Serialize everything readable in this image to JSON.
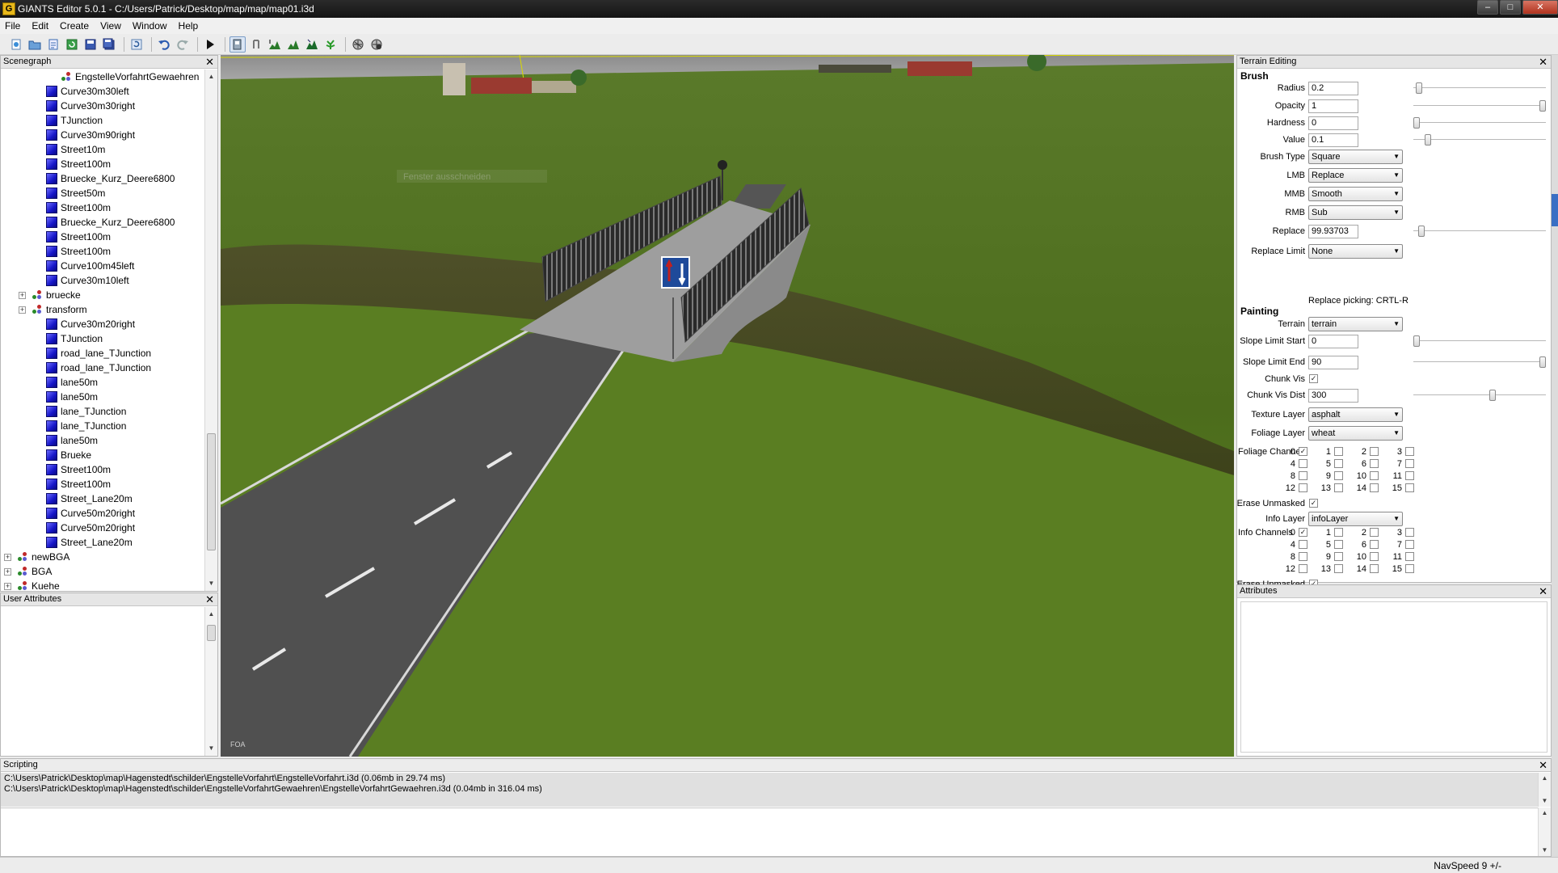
{
  "window": {
    "title": "GIANTS Editor 5.0.1 - C:/Users/Patrick/Desktop/map/map/map01.i3d",
    "icon_letter": "G",
    "controls": [
      "minimize-icon",
      "maximize-icon",
      "close-icon"
    ]
  },
  "menu": [
    "File",
    "Edit",
    "Create",
    "View",
    "Window",
    "Help"
  ],
  "toolbar": {
    "icons": [
      "new-icon",
      "open-icon",
      "import-icon",
      "reload-icon",
      "save-icon",
      "save-all-icon",
      "refresh-icon",
      "undo-icon",
      "redo-icon",
      "play-icon",
      "select-mode-icon",
      "move-mode-icon",
      "terrain-sculpt-icon",
      "terrain-paint-icon",
      "terrain-smooth-icon",
      "foliage-paint-icon",
      "grid-icon",
      "grid-settings-icon"
    ]
  },
  "scenegraph": {
    "title": "Scenegraph",
    "items": [
      {
        "label": "EngstelleVorfahrtGewaehren",
        "type": "transform",
        "level": 3
      },
      {
        "label": "Curve30m30left",
        "type": "shape",
        "level": 2
      },
      {
        "label": "Curve30m30right",
        "type": "shape",
        "level": 2
      },
      {
        "label": "TJunction",
        "type": "shape",
        "level": 2
      },
      {
        "label": "Curve30m90right",
        "type": "shape",
        "level": 2
      },
      {
        "label": "Street10m",
        "type": "shape",
        "level": 2
      },
      {
        "label": "Street100m",
        "type": "shape",
        "level": 2
      },
      {
        "label": "Bruecke_Kurz_Deere6800",
        "type": "shape",
        "level": 2
      },
      {
        "label": "Street50m",
        "type": "shape",
        "level": 2
      },
      {
        "label": "Street100m",
        "type": "shape",
        "level": 2
      },
      {
        "label": "Bruecke_Kurz_Deere6800",
        "type": "shape",
        "level": 2
      },
      {
        "label": "Street100m",
        "type": "shape",
        "level": 2
      },
      {
        "label": "Street100m",
        "type": "shape",
        "level": 2
      },
      {
        "label": "Curve100m45left",
        "type": "shape",
        "level": 2
      },
      {
        "label": "Curve30m10left",
        "type": "shape",
        "level": 2
      },
      {
        "label": "bruecke",
        "type": "transform",
        "level": 1,
        "expandable": true
      },
      {
        "label": "transform",
        "type": "transform",
        "level": 1,
        "expandable": true
      },
      {
        "label": "Curve30m20right",
        "type": "shape",
        "level": 2
      },
      {
        "label": "TJunction",
        "type": "shape",
        "level": 2
      },
      {
        "label": "road_lane_TJunction",
        "type": "shape",
        "level": 2
      },
      {
        "label": "road_lane_TJunction",
        "type": "shape",
        "level": 2
      },
      {
        "label": "lane50m",
        "type": "shape",
        "level": 2
      },
      {
        "label": "lane50m",
        "type": "shape",
        "level": 2
      },
      {
        "label": "lane_TJunction",
        "type": "shape",
        "level": 2
      },
      {
        "label": "lane_TJunction",
        "type": "shape",
        "level": 2
      },
      {
        "label": "lane50m",
        "type": "shape",
        "level": 2
      },
      {
        "label": "Brueke",
        "type": "shape",
        "level": 2
      },
      {
        "label": "Street100m",
        "type": "shape",
        "level": 2
      },
      {
        "label": "Street100m",
        "type": "shape",
        "level": 2
      },
      {
        "label": "Street_Lane20m",
        "type": "shape",
        "level": 2
      },
      {
        "label": "Curve50m20right",
        "type": "shape",
        "level": 2
      },
      {
        "label": "Curve50m20right",
        "type": "shape",
        "level": 2
      },
      {
        "label": "Street_Lane20m",
        "type": "shape",
        "level": 2
      },
      {
        "label": "newBGA",
        "type": "transform",
        "level": 0,
        "expandable": true
      },
      {
        "label": "BGA",
        "type": "transform",
        "level": 0,
        "expandable": true
      },
      {
        "label": "Kuehe",
        "type": "transform",
        "level": 0,
        "expandable": true
      }
    ]
  },
  "user_attributes": {
    "title": "User Attributes"
  },
  "viewport": {
    "overlay_text": "Fenster ausschneiden",
    "corner_text": "FOA",
    "colors": {
      "sky": "#9a9a9a",
      "grass": "#4f6e1f",
      "road": "#555555"
    }
  },
  "terrain_editing": {
    "title": "Terrain Editing",
    "brush_section": "Brush",
    "fields": [
      {
        "label": "Radius",
        "value": "0.2",
        "slider": 0.02
      },
      {
        "label": "Opacity",
        "value": "1",
        "slider": 1.0
      },
      {
        "label": "Hardness",
        "value": "0",
        "slider": 0.0
      },
      {
        "label": "Value",
        "value": "0.1",
        "slider": 0.09
      }
    ],
    "brush_type": {
      "label": "Brush Type",
      "value": "Square"
    },
    "lmb": {
      "label": "LMB",
      "value": "Replace"
    },
    "mmb": {
      "label": "MMB",
      "value": "Smooth"
    },
    "rmb": {
      "label": "RMB",
      "value": "Sub"
    },
    "replace": {
      "label": "Replace",
      "value": "99.93703",
      "slider": 0.04
    },
    "replace_limit": {
      "label": "Replace Limit",
      "value": "None"
    },
    "replace_picking": "Replace picking: CRTL-R",
    "painting_section": "Painting",
    "terrain": {
      "label": "Terrain",
      "value": "terrain"
    },
    "slope_start": {
      "label": "Slope Limit Start",
      "value": "0",
      "slider": 0.0
    },
    "slope_end": {
      "label": "Slope Limit End",
      "value": "90",
      "slider": 1.0
    },
    "chunk_vis": {
      "label": "Chunk Vis",
      "checked": true
    },
    "chunk_vis_dist": {
      "label": "Chunk Vis Dist",
      "value": "300",
      "slider": 0.6
    },
    "texture_layer": {
      "label": "Texture Layer",
      "value": "asphalt"
    },
    "foliage_layer": {
      "label": "Foliage Layer",
      "value": "wheat"
    },
    "foliage_channels": {
      "label": "Foliage Channels",
      "checked": [
        0
      ]
    },
    "erase_unmasked_1": {
      "label": "Erase Unmasked",
      "checked": true
    },
    "info_layer": {
      "label": "Info Layer",
      "value": "infoLayer"
    },
    "info_channels": {
      "label": "Info Channels",
      "checked": [
        0
      ]
    },
    "erase_unmasked_2": {
      "label": "Erase Unmasked",
      "checked": true
    },
    "channel_numbers": [
      "0",
      "1",
      "2",
      "3",
      "4",
      "5",
      "6",
      "7",
      "8",
      "9",
      "10",
      "11",
      "12",
      "13",
      "14",
      "15"
    ]
  },
  "attributes": {
    "title": "Attributes"
  },
  "scripting": {
    "title": "Scripting",
    "log": [
      "C:\\Users\\Patrick\\Desktop\\map\\Hagenstedt\\schilder\\EngstelleVorfahrt\\EngstelleVorfahrt.i3d (0.06mb in 29.74 ms)",
      "C:\\Users\\Patrick\\Desktop\\map\\Hagenstedt\\schilder\\EngstelleVorfahrtGewaehren\\EngstelleVorfahrtGewaehren.i3d (0.04mb in 316.04 ms)"
    ]
  },
  "status": {
    "nav_speed": "NavSpeed 9 +/-"
  }
}
